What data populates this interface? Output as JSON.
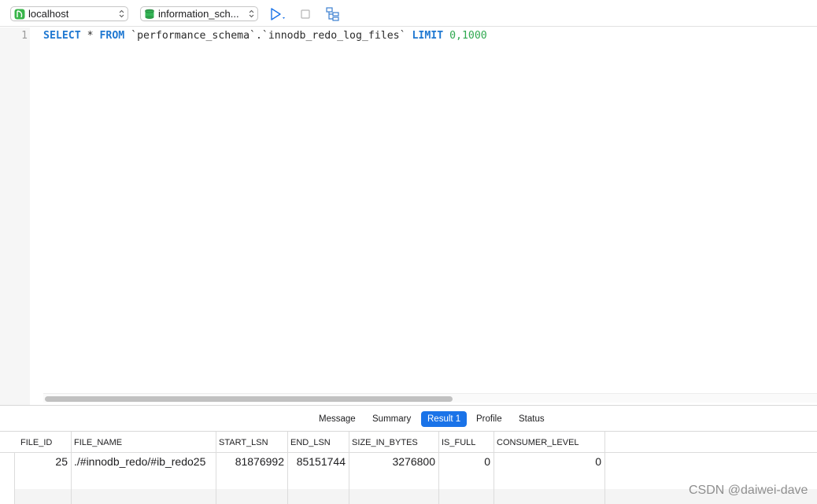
{
  "toolbar": {
    "connection": "localhost",
    "database": "information_sch...",
    "icons": [
      "elephant-icon",
      "database-icon",
      "run-icon",
      "stop-icon",
      "explain-icon"
    ]
  },
  "editor": {
    "line_number": "1",
    "sql": {
      "kw_select": "SELECT",
      "star": " * ",
      "kw_from": "FROM",
      "table": " `performance_schema`.`innodb_redo_log_files` ",
      "kw_limit": "LIMIT",
      "limit_values": " 0,1000"
    }
  },
  "tabs": [
    {
      "label": "Message"
    },
    {
      "label": "Summary"
    },
    {
      "label": "Result 1",
      "active": true
    },
    {
      "label": "Profile"
    },
    {
      "label": "Status"
    }
  ],
  "result": {
    "columns": [
      "FILE_ID",
      "FILE_NAME",
      "START_LSN",
      "END_LSN",
      "SIZE_IN_BYTES",
      "IS_FULL",
      "CONSUMER_LEVEL"
    ],
    "rows": [
      [
        "25",
        "./#innodb_redo/#ib_redo25",
        "81876992",
        "85151744",
        "3276800",
        "0",
        "0"
      ]
    ]
  },
  "watermark": "CSDN @daiwei-dave",
  "colors": {
    "keyword": "#1f78d1",
    "number": "#2fa84f",
    "active_tab": "#1a73e8"
  }
}
